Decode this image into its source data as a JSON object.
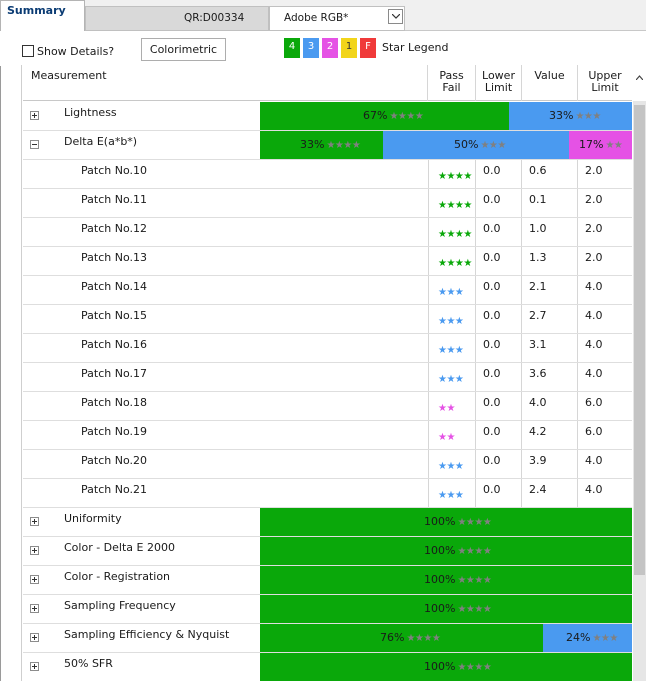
{
  "tabs": {
    "summary": "Summary",
    "qr": "QR:D00334",
    "color_space": "Adobe RGB*"
  },
  "controls": {
    "show_details": "Show Details?",
    "colorimetric": "Colorimetric",
    "star_key": [
      "4",
      "3",
      "2",
      "1",
      "F"
    ],
    "star_legend": "Star Legend"
  },
  "colors": {
    "grade4": "#0aa80a",
    "grade3": "#4a9af0",
    "grade2": "#e552e5",
    "grade1": "#f2d51a",
    "fail": "#f03a3a"
  },
  "table": {
    "headers": {
      "measurement": "Measurement",
      "pass_fail_1": "Pass",
      "pass_fail_2": "Fail",
      "lower_1": "Lower",
      "lower_2": "Limit",
      "value": "Value",
      "upper_1": "Upper",
      "upper_2": "Limit"
    },
    "lightness": {
      "name": "Lightness",
      "bars": [
        {
          "pct": "67%",
          "stars": "★★★★",
          "fraction": 0.67,
          "color": "green"
        },
        {
          "pct": "33%",
          "stars": "★★★",
          "fraction": 0.33,
          "color": "blue"
        }
      ]
    },
    "delta_e": {
      "name": "Delta E(a*b*)",
      "bars": [
        {
          "pct": "33%",
          "stars": "★★★★",
          "fraction": 0.33,
          "color": "green"
        },
        {
          "pct": "50%",
          "stars": "★★★",
          "fraction": 0.5,
          "color": "blue"
        },
        {
          "pct": "17%",
          "stars": "★★",
          "fraction": 0.17,
          "color": "pink"
        }
      ]
    },
    "patches": [
      {
        "name": "Patch No.10",
        "stars": "★★★★",
        "grade": 4,
        "lower": "0.0",
        "value": "0.6",
        "upper": "2.0"
      },
      {
        "name": "Patch No.11",
        "stars": "★★★★",
        "grade": 4,
        "lower": "0.0",
        "value": "0.1",
        "upper": "2.0"
      },
      {
        "name": "Patch No.12",
        "stars": "★★★★",
        "grade": 4,
        "lower": "0.0",
        "value": "1.0",
        "upper": "2.0"
      },
      {
        "name": "Patch No.13",
        "stars": "★★★★",
        "grade": 4,
        "lower": "0.0",
        "value": "1.3",
        "upper": "2.0"
      },
      {
        "name": "Patch No.14",
        "stars": "★★★",
        "grade": 3,
        "lower": "0.0",
        "value": "2.1",
        "upper": "4.0"
      },
      {
        "name": "Patch No.15",
        "stars": "★★★",
        "grade": 3,
        "lower": "0.0",
        "value": "2.7",
        "upper": "4.0"
      },
      {
        "name": "Patch No.16",
        "stars": "★★★",
        "grade": 3,
        "lower": "0.0",
        "value": "3.1",
        "upper": "4.0"
      },
      {
        "name": "Patch No.17",
        "stars": "★★★",
        "grade": 3,
        "lower": "0.0",
        "value": "3.6",
        "upper": "4.0"
      },
      {
        "name": "Patch No.18",
        "stars": "★★",
        "grade": 2,
        "lower": "0.0",
        "value": "4.0",
        "upper": "6.0"
      },
      {
        "name": "Patch No.19",
        "stars": "★★",
        "grade": 2,
        "lower": "0.0",
        "value": "4.2",
        "upper": "6.0"
      },
      {
        "name": "Patch No.20",
        "stars": "★★★",
        "grade": 3,
        "lower": "0.0",
        "value": "3.9",
        "upper": "4.0"
      },
      {
        "name": "Patch No.21",
        "stars": "★★★",
        "grade": 3,
        "lower": "0.0",
        "value": "2.4",
        "upper": "4.0"
      }
    ],
    "groups": [
      {
        "name": "Uniformity",
        "bars": [
          {
            "pct": "100%",
            "stars": "★★★★",
            "fraction": 1.0,
            "color": "green"
          }
        ]
      },
      {
        "name": "Color - Delta E 2000",
        "bars": [
          {
            "pct": "100%",
            "stars": "★★★★",
            "fraction": 1.0,
            "color": "green"
          }
        ]
      },
      {
        "name": "Color - Registration",
        "bars": [
          {
            "pct": "100%",
            "stars": "★★★★",
            "fraction": 1.0,
            "color": "green"
          }
        ]
      },
      {
        "name": "Sampling Frequency",
        "bars": [
          {
            "pct": "100%",
            "stars": "★★★★",
            "fraction": 1.0,
            "color": "green"
          }
        ]
      },
      {
        "name": "Sampling Efficiency & Nyquist",
        "bars": [
          {
            "pct": "76%",
            "stars": "★★★★",
            "fraction": 0.76,
            "color": "green"
          },
          {
            "pct": "24%",
            "stars": "★★★",
            "fraction": 0.24,
            "color": "blue"
          }
        ]
      },
      {
        "name": "50% SFR",
        "bars": [
          {
            "pct": "100%",
            "stars": "★★★★",
            "fraction": 1.0,
            "color": "green"
          }
        ]
      }
    ]
  }
}
